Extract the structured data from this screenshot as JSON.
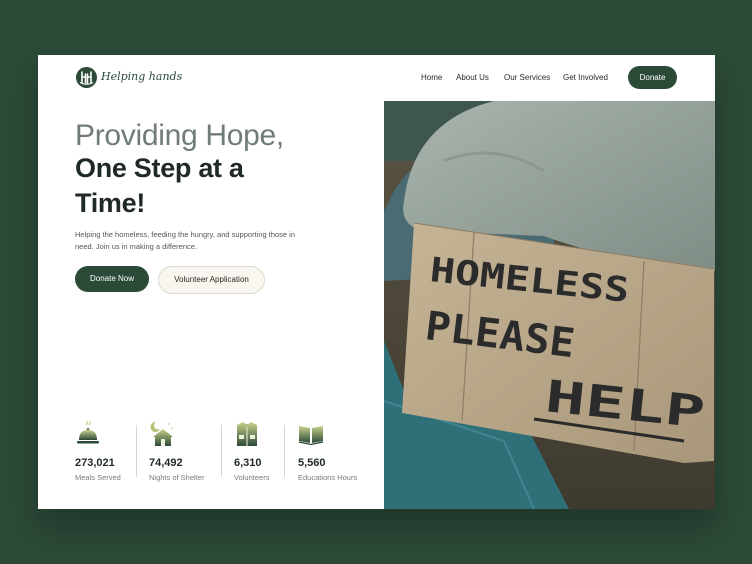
{
  "brand": {
    "name": "Helping  hands",
    "logo_icon": "hh-monogram-icon"
  },
  "nav": {
    "items": [
      {
        "label": "Home"
      },
      {
        "label": "About Us"
      },
      {
        "label": "Our Services"
      },
      {
        "label": "Get Involved"
      }
    ],
    "donate_label": "Donate"
  },
  "hero": {
    "line1": "Providing Hope,",
    "line2": "One Step at a",
    "line3": "Time!",
    "description": "Helping the homeless, feeding the hungry, and supporting those in need. Join us in making a difference.",
    "primary_button": "Donate Now",
    "secondary_button": "Volunteer Application"
  },
  "stats": [
    {
      "value": "273,021",
      "label": "Meals Served",
      "icon": "food-cloche-icon"
    },
    {
      "value": "74,492",
      "label": "Nights of Shelter",
      "icon": "night-house-icon"
    },
    {
      "value": "6,310",
      "label": "Volunteers",
      "icon": "volunteer-vest-icon"
    },
    {
      "value": "5,560",
      "label": "Educations Hours",
      "icon": "open-book-icon"
    }
  ],
  "photo": {
    "sign_lines": [
      "HOMELESS",
      "PLEASE",
      "HELP"
    ]
  },
  "colors": {
    "background": "#2c4a38",
    "accent": "#2c4a38",
    "heading_light": "#6f7d74",
    "heading_dark": "#1f2a24"
  }
}
